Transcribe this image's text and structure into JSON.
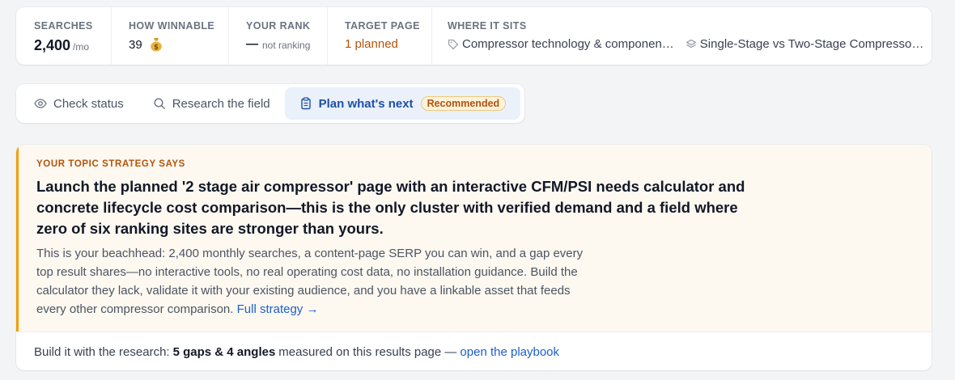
{
  "stats": {
    "searches": {
      "label": "SEARCHES",
      "value": "2,400",
      "unit": "/mo"
    },
    "winnable": {
      "label": "HOW WINNABLE",
      "value": "39",
      "icon": "money-bag-icon"
    },
    "rank": {
      "label": "YOUR RANK",
      "value": "—",
      "note": "not ranking"
    },
    "target": {
      "label": "TARGET PAGE",
      "value": "1 planned"
    },
    "where": {
      "label": "WHERE IT SITS",
      "items": [
        {
          "icon": "tag-icon",
          "text": "Compressor technology & componen…"
        },
        {
          "icon": "layers-icon",
          "text": "Single-Stage vs Two-Stage Compresso…"
        }
      ]
    }
  },
  "tabs": [
    {
      "label": "Check status",
      "icon": "eye-icon"
    },
    {
      "label": "Research the field",
      "icon": "search-icon"
    },
    {
      "label": "Plan what's next",
      "icon": "clipboard-icon",
      "badge": "Recommended"
    }
  ],
  "strategy": {
    "eyebrow": "YOUR TOPIC STRATEGY SAYS",
    "headline": "Launch the planned '2 stage air compressor' page with an interactive CFM/PSI needs calculator and concrete lifecycle cost comparison—this is the only cluster with verified demand and a field where zero of six ranking sites are stronger than yours.",
    "body": "This is your beachhead: 2,400 monthly searches, a content-page SERP you can win, and a gap every top result shares—no interactive tools, no real operating cost data, no installation guidance. Build the calculator they lack, validate it with your existing audience, and you have a linkable asset that feeds every other compressor comparison.",
    "full_link": "Full strategy →",
    "footer_prefix": "Build it with the research:",
    "footer_bold": "5 gaps & 4 angles",
    "footer_mid": "measured on this results page —",
    "footer_link": "open the playbook"
  },
  "colors": {
    "accent": "#1e4fa8",
    "warning": "#b45309",
    "strategy_bg": "#fdf8f0",
    "strategy_border": "#f59e0b"
  }
}
